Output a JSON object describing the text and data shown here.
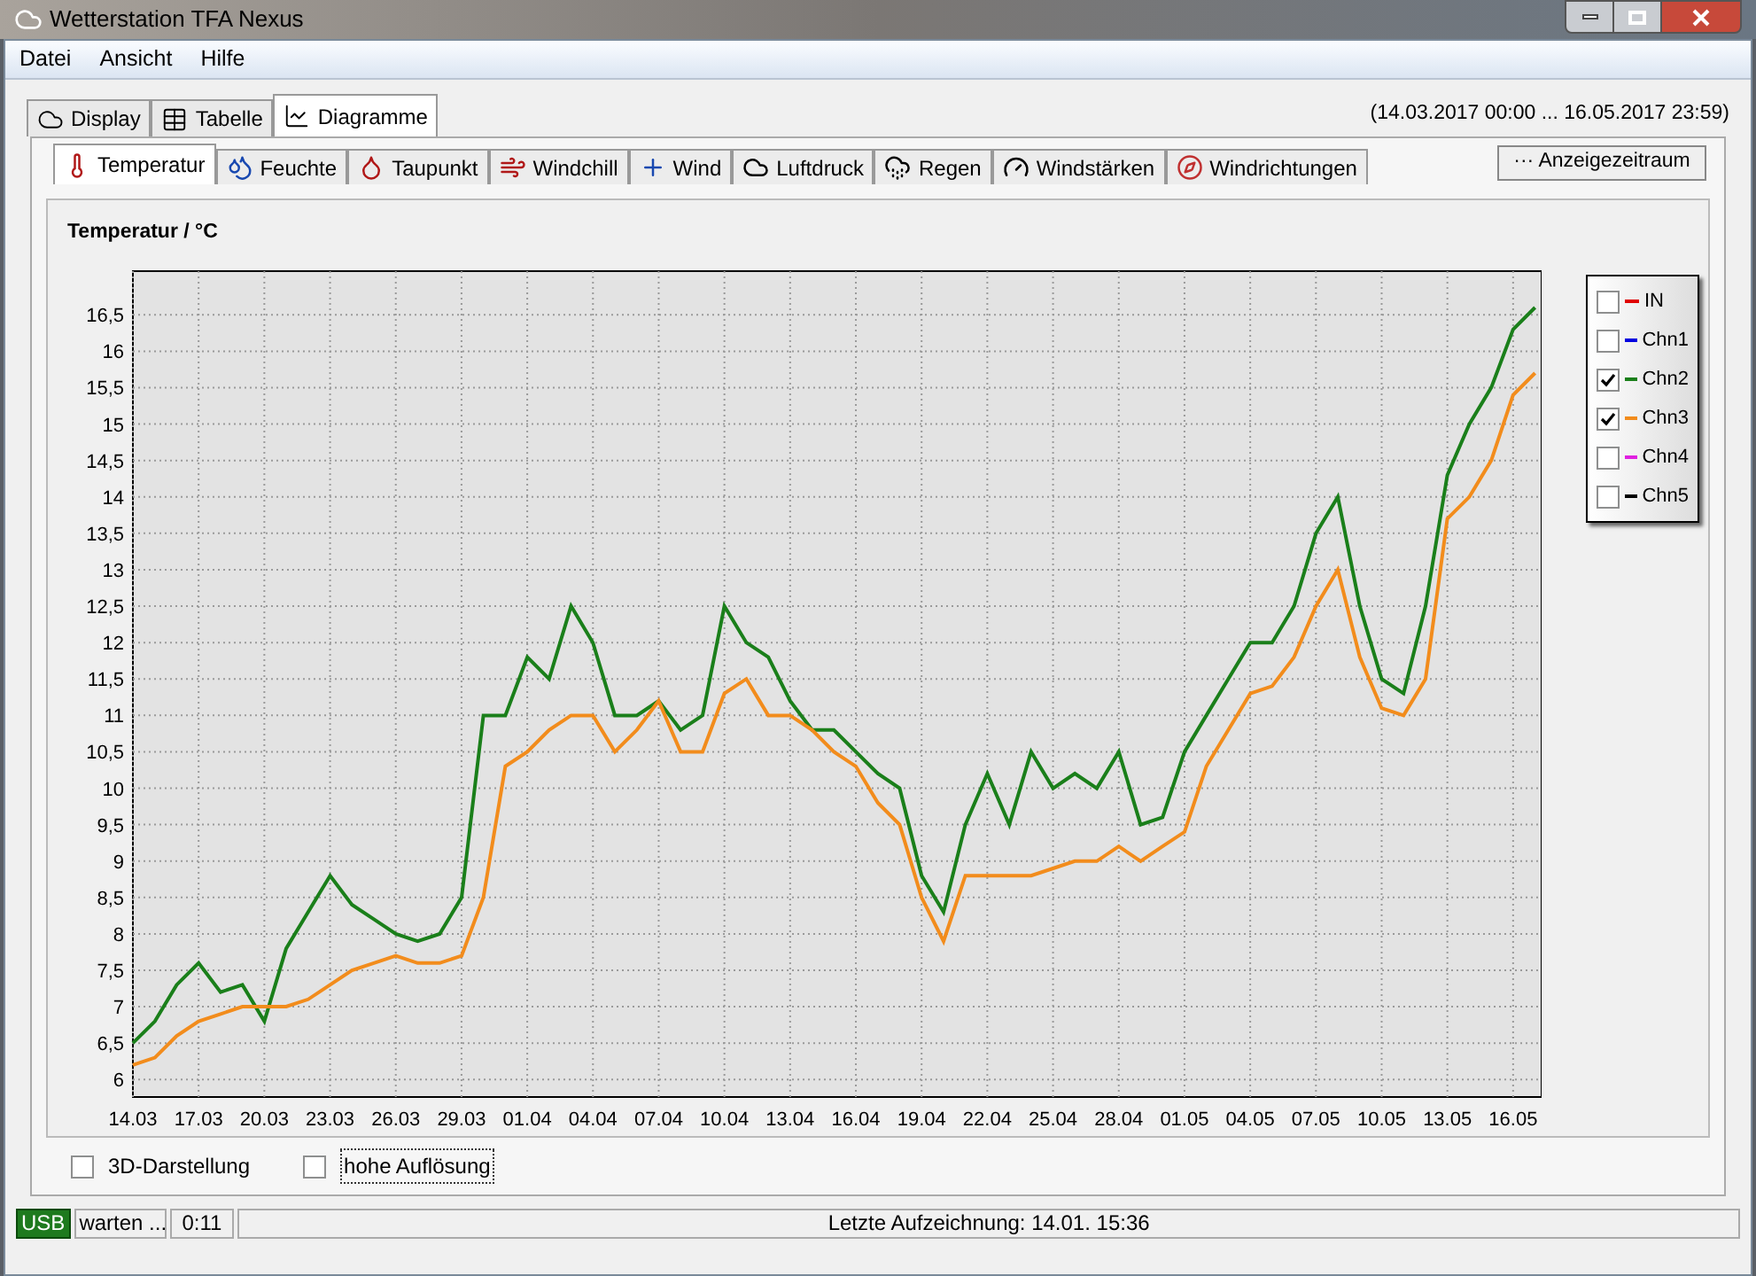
{
  "window": {
    "title": "Wetterstation TFA Nexus"
  },
  "menu": [
    "Datei",
    "Ansicht",
    "Hilfe"
  ],
  "main_tabs": [
    {
      "label": "Display",
      "selected": false
    },
    {
      "label": "Tabelle",
      "selected": false
    },
    {
      "label": "Diagramme",
      "selected": true
    }
  ],
  "date_range": "(14.03.2017 00:00 ... 16.05.2017 23:59)",
  "chart_tabs": [
    {
      "label": "Temperatur",
      "selected": true
    },
    {
      "label": "Feuchte",
      "selected": false
    },
    {
      "label": "Taupunkt",
      "selected": false
    },
    {
      "label": "Windchill",
      "selected": false
    },
    {
      "label": "Wind",
      "selected": false
    },
    {
      "label": "Luftdruck",
      "selected": false
    },
    {
      "label": "Regen",
      "selected": false
    },
    {
      "label": "Windstärken",
      "selected": false
    },
    {
      "label": "Windrichtungen",
      "selected": false
    }
  ],
  "period_button": "··· Anzeigezeitraum",
  "chart": {
    "chart_data": {
      "type": "line",
      "title": "Temperatur / °C",
      "categories": [
        "14.03",
        null,
        null,
        "17.03",
        null,
        null,
        "20.03",
        null,
        null,
        "23.03",
        null,
        null,
        "26.03",
        null,
        null,
        "29.03",
        null,
        null,
        "01.04",
        null,
        null,
        "04.04",
        null,
        null,
        "07.04",
        null,
        null,
        "10.04",
        null,
        null,
        "13.04",
        null,
        null,
        "16.04",
        null,
        null,
        "19.04",
        null,
        null,
        "22.04",
        null,
        null,
        "25.04",
        null,
        null,
        "28.04",
        null,
        null,
        "01.05",
        null,
        null,
        "04.05",
        null,
        null,
        "07.05",
        null,
        null,
        "10.05",
        null,
        null,
        "13.05",
        null,
        null,
        "16.05",
        null
      ],
      "series": [
        {
          "color": "#1a7f1a",
          "values": [
            6.5,
            6.8,
            7.3,
            7.6,
            7.2,
            7.3,
            6.8,
            7.8,
            8.3,
            8.8,
            8.4,
            8.2,
            8.0,
            7.9,
            8.0,
            8.5,
            11.0,
            11.0,
            11.8,
            11.5,
            12.5,
            12.0,
            11.0,
            11.0,
            11.2,
            10.8,
            11.0,
            12.5,
            12.0,
            11.8,
            11.2,
            10.8,
            10.8,
            10.5,
            10.2,
            10.0,
            8.8,
            8.3,
            9.5,
            10.2,
            9.5,
            10.5,
            10.0,
            10.2,
            10.0,
            10.5,
            9.5,
            9.6,
            10.5,
            11.0,
            11.5,
            12.0,
            12.0,
            12.5,
            13.5,
            14.0,
            12.5,
            11.5,
            11.3,
            12.5,
            14.3,
            15.0,
            15.5,
            16.3,
            16.6
          ]
        },
        {
          "color": "#f28c1c",
          "values": [
            6.2,
            6.3,
            6.6,
            6.8,
            6.9,
            7.0,
            7.0,
            7.0,
            7.1,
            7.3,
            7.5,
            7.6,
            7.7,
            7.6,
            7.6,
            7.7,
            8.5,
            10.3,
            10.5,
            10.8,
            11.0,
            11.0,
            10.5,
            10.8,
            11.2,
            10.5,
            10.5,
            11.3,
            11.5,
            11.0,
            11.0,
            10.8,
            10.5,
            10.3,
            9.8,
            9.5,
            8.5,
            7.9,
            8.8,
            8.8,
            8.8,
            8.8,
            8.9,
            9.0,
            9.0,
            9.2,
            9.0,
            9.2,
            9.4,
            10.3,
            10.8,
            11.3,
            11.4,
            11.8,
            12.5,
            13.0,
            11.8,
            11.1,
            11.0,
            11.5,
            13.7,
            14.0,
            14.5,
            15.4,
            15.7
          ]
        }
      ],
      "ylim": [
        5.76,
        17.1
      ],
      "grid": true,
      "yticks": [
        {
          "value": 6,
          "label": "6"
        },
        {
          "value": 6.5,
          "label": "6,5"
        },
        {
          "value": 7,
          "label": "7"
        },
        {
          "value": 7.5,
          "label": "7,5"
        },
        {
          "value": 8,
          "label": "8"
        },
        {
          "value": 8.5,
          "label": "8,5"
        },
        {
          "value": 9,
          "label": "9"
        },
        {
          "value": 9.5,
          "label": "9,5"
        },
        {
          "value": 10,
          "label": "10"
        },
        {
          "value": 10.5,
          "label": "10,5"
        },
        {
          "value": 11,
          "label": "11"
        },
        {
          "value": 11.5,
          "label": "11,5"
        },
        {
          "value": 12,
          "label": "12"
        },
        {
          "value": 12.5,
          "label": "12,5"
        },
        {
          "value": 13,
          "label": "13"
        },
        {
          "value": 13.5,
          "label": "13,5"
        },
        {
          "value": 14,
          "label": "14"
        },
        {
          "value": 14.5,
          "label": "14,5"
        },
        {
          "value": 15,
          "label": "15"
        },
        {
          "value": 15.5,
          "label": "15,5"
        },
        {
          "value": 16,
          "label": "16"
        },
        {
          "value": 16.5,
          "label": "16,5"
        }
      ]
    },
    "legend": [
      {
        "label": "IN",
        "checked": false,
        "color": "#e00000"
      },
      {
        "label": "Chn1",
        "checked": false,
        "color": "#0000e0"
      },
      {
        "label": "Chn2",
        "checked": true,
        "color": "#1a7f1a"
      },
      {
        "label": "Chn3",
        "checked": true,
        "color": "#f28c1c"
      },
      {
        "label": "Chn4",
        "checked": false,
        "color": "#e020e0"
      },
      {
        "label": "Chn5",
        "checked": false,
        "color": "#000000"
      }
    ]
  },
  "options": [
    {
      "label": "3D-Darstellung",
      "checked": false
    },
    {
      "label": "hohe Auflösung",
      "checked": false
    }
  ],
  "status_bar": {
    "connection": "USB",
    "state": "warten ...",
    "time": "0:11",
    "last_record": "Letzte Aufzeichnung: 14.01. 15:36"
  }
}
